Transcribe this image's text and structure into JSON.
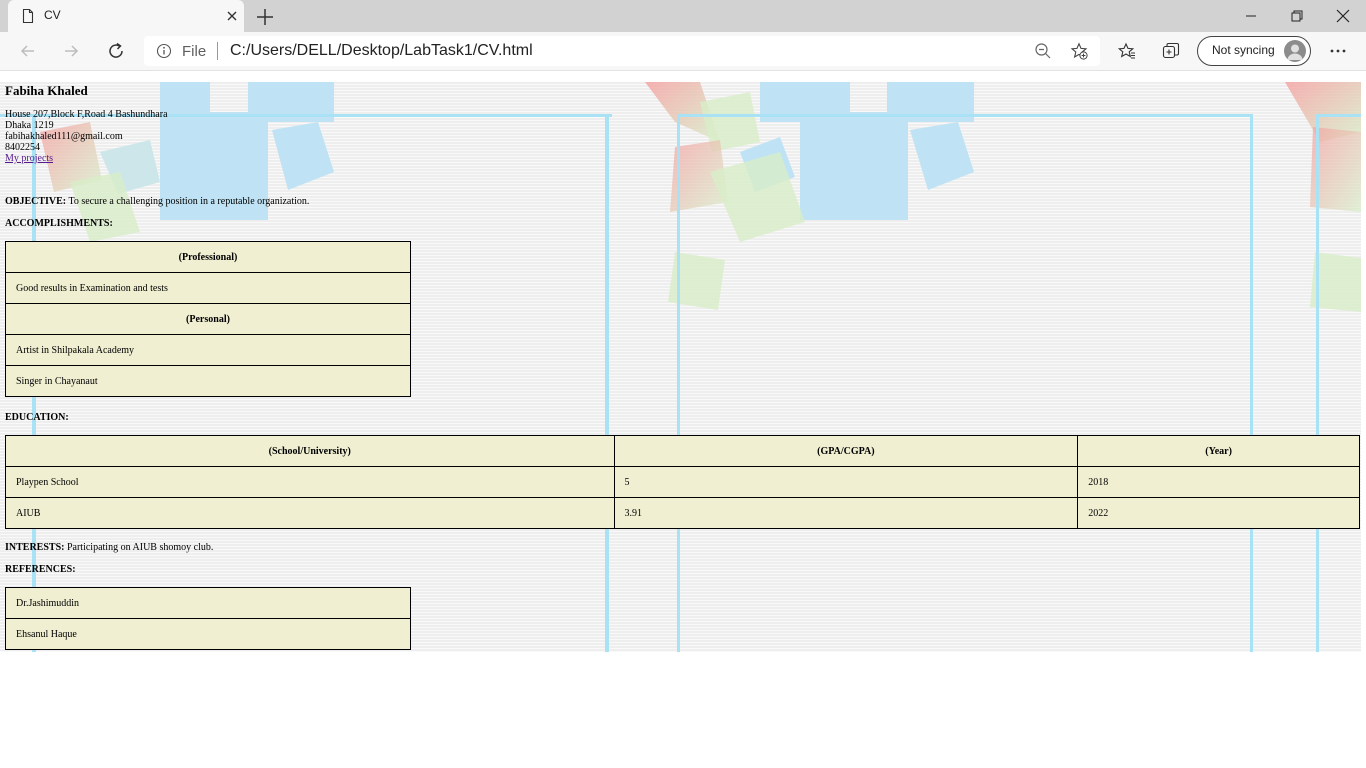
{
  "browser": {
    "tab_title": "CV",
    "file_label": "File",
    "url": "C:/Users/DELL/Desktop/LabTask1/CV.html",
    "sync_label": "Not syncing",
    "icons": [
      "page-icon",
      "close-icon",
      "plus-icon",
      "minimize-icon",
      "restore-icon",
      "close-window-icon",
      "back-arrow-icon",
      "forward-arrow-icon",
      "refresh-icon",
      "info-icon",
      "zoom-out-icon",
      "add-favorite-icon",
      "favorites-icon",
      "collections-icon",
      "avatar-icon",
      "more-icon"
    ]
  },
  "cv": {
    "name": "Fabiha Khaled",
    "address1": "House 207,Block F,Road 4 Bashundhara",
    "address2": "Dhaka 1219",
    "email": "fabihakhaled111@gmail.com",
    "phone": "8402254",
    "projects_link": "My projects",
    "objective_label": "OBJECTIVE:",
    "objective_text": " To secure a challenging position in a reputable organization.",
    "accomplishments_label": "ACCOMPLISHMENTS:",
    "accomplishments": {
      "professional_header": "(Professional)",
      "professional": [
        "Good results in Examination and tests"
      ],
      "personal_header": "(Personal)",
      "personal": [
        "Artist in Shilpakala Academy",
        "Singer in Chayanaut"
      ]
    },
    "education_label": "EDUCATION:",
    "education": {
      "headers": [
        "(School/University)",
        "(GPA/CGPA)",
        "(Year)"
      ],
      "rows": [
        [
          "Playpen School",
          "5",
          "2018"
        ],
        [
          "AIUB",
          "3.91",
          "2022"
        ]
      ]
    },
    "interests_label": "INTERESTS:",
    "interests_text": " Participating on AIUB shomoy club.",
    "references_label": "REFERENCES:",
    "references": [
      "Dr.Jashimuddin",
      "Ehsanul Haque"
    ]
  }
}
